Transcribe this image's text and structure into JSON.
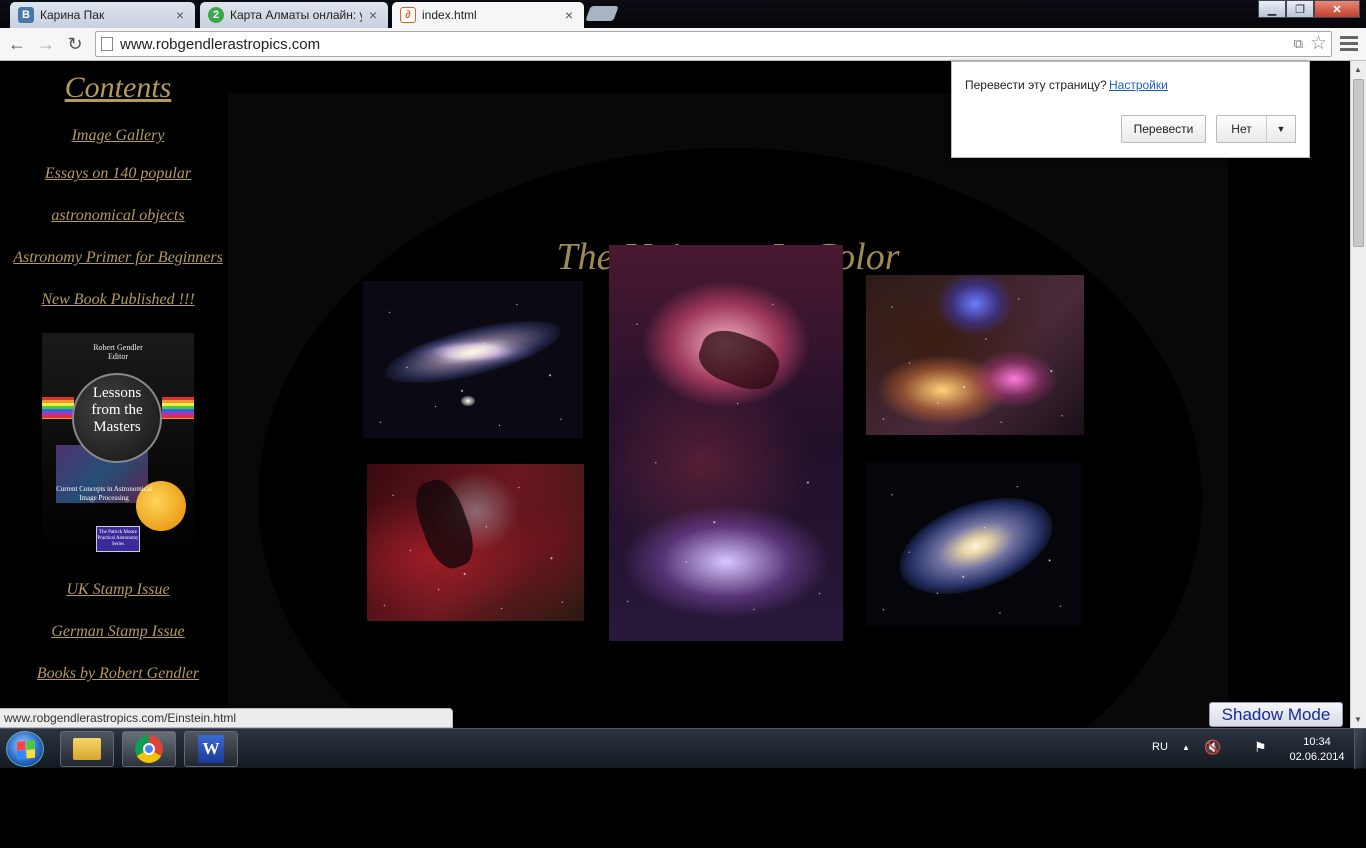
{
  "browser": {
    "tabs": [
      {
        "title": "Карина Пак",
        "favicon": "vk-icon",
        "favicon_text": "B",
        "favicon_color": "#4a76a8",
        "active": false
      },
      {
        "title": "Карта Алматы онлайн: ул",
        "favicon": "2gis-icon",
        "favicon_text": "2",
        "favicon_color": "#3aa84a",
        "active": false
      },
      {
        "title": "index.html",
        "favicon": "page-icon",
        "favicon_text": "",
        "favicon_color": "#ffffff",
        "active": true
      }
    ],
    "url": "www.robgendlerastropics.com",
    "window_controls": {
      "minimize": "▁",
      "maximize": "❐",
      "close": "✕"
    }
  },
  "translate_popup": {
    "question": "Перевести эту страницу?",
    "settings_link": "Настройки",
    "translate_button": "Перевести",
    "no_button": "Нет"
  },
  "sidebar": {
    "title": "Contents",
    "links": [
      "Image Gallery",
      "Essays on 140 popular",
      "astronomical objects",
      "Astronomy Primer for Beginners",
      "New Book Published !!!",
      "UK Stamp Issue",
      "German Stamp Issue",
      "Books by Robert Gendler"
    ],
    "book": {
      "editor": "Robert Gendler\nEditor",
      "title": "Lessons\nfrom the\nMasters",
      "subtitle": "Current Concepts in Astronomical Image Processing",
      "series": "The Patrick Moore Practical Astronomy Series"
    }
  },
  "main": {
    "title": "The Universe In Color"
  },
  "status_url": "www.robgendlerastropics.com/Einstein.html",
  "shadow_mode_label": "Shadow Mode",
  "taskbar": {
    "language": "RU",
    "time": "10:34",
    "date": "02.06.2014"
  },
  "colors": {
    "link_gold": "#b39b5c",
    "title_gold": "#9e8a55",
    "settings_link_blue": "#1a5fc4"
  }
}
